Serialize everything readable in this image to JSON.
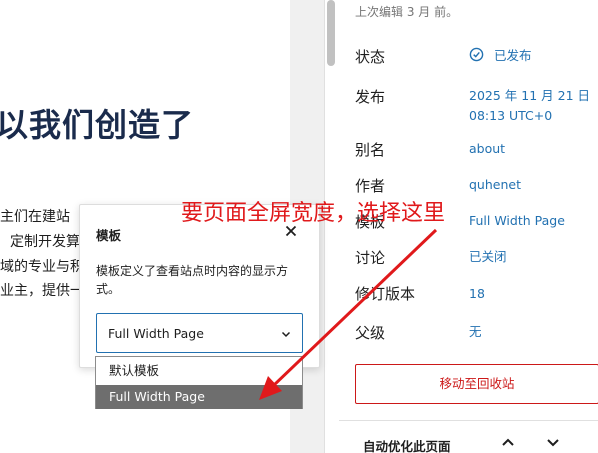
{
  "canvas": {
    "heading": "以我们创造了",
    "paragraphs": [
      "主们在建站",
      "定制开发算",
      "域的专业与积",
      "业主，提供一"
    ]
  },
  "sidebar": {
    "last_edited": "上次编辑 3 月 前。",
    "rows": [
      {
        "label": "状态",
        "value": "已发布"
      },
      {
        "label": "发布",
        "value": "2025 年 11 月 21 日",
        "value2": "08:13 UTC+0"
      },
      {
        "label": "别名",
        "value": "about"
      },
      {
        "label": "作者",
        "value": "quhenet"
      },
      {
        "label": "模板",
        "value": "Full Width Page"
      },
      {
        "label": "讨论",
        "value": "已关闭"
      },
      {
        "label": "修订版本",
        "value": "18"
      },
      {
        "label": "父级",
        "value": "无"
      }
    ],
    "trash_label": "移动至回收站",
    "seo_panel_title": "自动优化此页面"
  },
  "popover": {
    "title": "模板",
    "description": "模板定义了查看站点时内容的显示方式。",
    "selected": "Full Width Page",
    "options": [
      "默认模板",
      "Full Width Page"
    ]
  },
  "annotation": {
    "text": "要页面全屏宽度，选择这里"
  },
  "icons": {
    "status": "check-circle-icon",
    "close": "close-icon",
    "select_chevron": "chevron-down-icon",
    "collapse": "chevron-up-icon",
    "expand": "chevron-down-icon"
  },
  "colors": {
    "link": "#2271b1",
    "danger": "#cc1818",
    "annotation": "#e0191b",
    "heading": "#1a2b4c",
    "selected_option_bg": "#6e6e6e"
  }
}
